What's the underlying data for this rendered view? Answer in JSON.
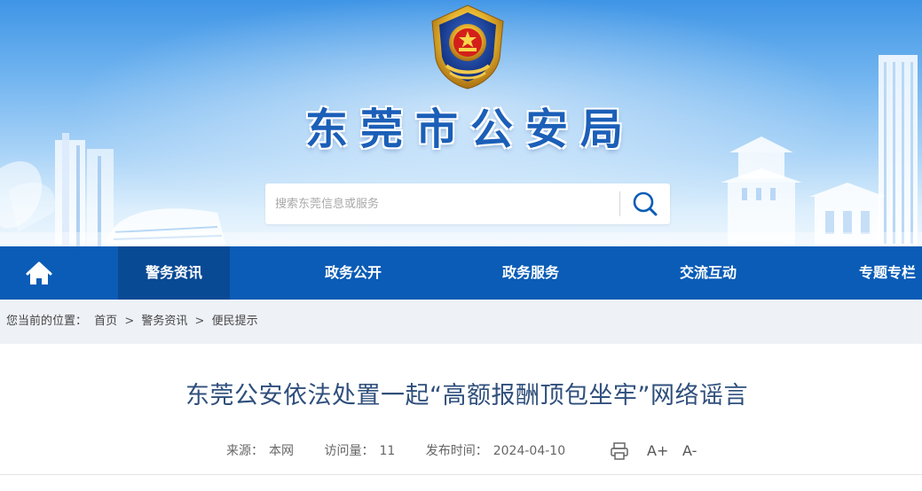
{
  "header": {
    "site_title": "东莞市公安局",
    "emblem_icon": "police-emblem-icon",
    "colors": {
      "title": "#1b5fb8",
      "sky_top": "#3f95e6",
      "sky_bottom": "#eef7fe"
    }
  },
  "search": {
    "placeholder": "搜索东莞信息或服务",
    "button_icon": "search-icon"
  },
  "nav": {
    "home_icon": "home-icon",
    "items": [
      {
        "label": "警务资讯",
        "active": true
      },
      {
        "label": "政务公开",
        "active": false
      },
      {
        "label": "政务服务",
        "active": false
      },
      {
        "label": "交流互动",
        "active": false
      },
      {
        "label": "专题专栏",
        "active": false
      }
    ],
    "colors": {
      "bar": "#0a5cb6",
      "active": "#094a94"
    }
  },
  "breadcrumb": {
    "prefix": "您当前的位置：",
    "items": [
      "首页",
      "警务资讯",
      "便民提示"
    ],
    "separator": ">"
  },
  "article": {
    "title": "东莞公安依法处置一起“高额报酬顶包坐牢”网络谣言",
    "source_label": "来源：",
    "source_value": "本网",
    "visits_label": "访问量：",
    "visits_value": "11",
    "date_label": "发布时间：",
    "date_value": "2024-04-10",
    "tools": [
      "print-icon",
      "font-increase-icon",
      "font-decrease-icon"
    ],
    "font_increase_label": "A+",
    "font_decrease_label": "A-"
  }
}
